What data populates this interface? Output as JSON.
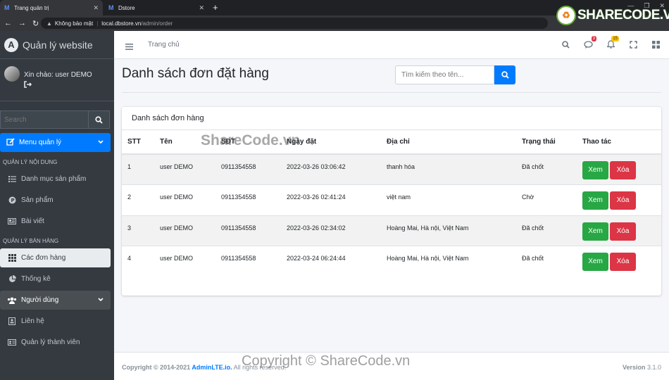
{
  "browser": {
    "tabs": [
      {
        "label": "Trang quản trị",
        "favicon": "M"
      },
      {
        "label": "Dstore",
        "favicon": "M"
      }
    ],
    "security_label": "Không bảo mật",
    "url_host": "local.dbstore.vn",
    "url_path": "/admin/order"
  },
  "sidebar": {
    "brand": "Quản lý website",
    "greeting": "Xin chào: user DEMO",
    "search_placeholder": "Search",
    "menu_toggle": "Menu quản lý",
    "section_content": "QUẢN LÝ NỘI DUNG",
    "section_sales": "QUẢN LÝ BÁN HÀNG",
    "items": [
      {
        "label": "Danh mục sản phẩm",
        "icon": "list-icon"
      },
      {
        "label": "Sản phẩm",
        "icon": "product-icon"
      },
      {
        "label": "Bài viết",
        "icon": "article-icon"
      },
      {
        "label": "Các đơn hàng",
        "icon": "grid-icon"
      },
      {
        "label": "Thống kê",
        "icon": "pie-chart-icon"
      },
      {
        "label": "Người dùng",
        "icon": "users-icon"
      },
      {
        "label": "Liên hệ",
        "icon": "contact-icon"
      },
      {
        "label": "Quản lý thành viên",
        "icon": "id-card-icon"
      }
    ]
  },
  "topnav": {
    "home": "Trang chủ",
    "messages_badge": "3",
    "notifications_badge": "15"
  },
  "header": {
    "title": "Danh sách đơn đặt hàng",
    "search_placeholder": "Tìm kiếm theo tên..."
  },
  "card": {
    "title": "Danh sách đơn hàng",
    "columns": [
      "STT",
      "Tên",
      "SĐT",
      "Ngày đặt",
      "Địa chỉ",
      "Trạng thái",
      "Thao tác"
    ],
    "rows": [
      {
        "stt": "1",
        "name": "user DEMO",
        "phone": "0911354558",
        "date": "2022-03-26 03:06:42",
        "address": "thanh hóa",
        "status": "Đã chốt"
      },
      {
        "stt": "2",
        "name": "user DEMO",
        "phone": "0911354558",
        "date": "2022-03-26 02:41:24",
        "address": "việt nam",
        "status": "Chờ"
      },
      {
        "stt": "3",
        "name": "user DEMO",
        "phone": "0911354558",
        "date": "2022-03-26 02:34:02",
        "address": "Hoàng Mai, Hà nội, Việt Nam",
        "status": "Đã chốt"
      },
      {
        "stt": "4",
        "name": "user DEMO",
        "phone": "0911354558",
        "date": "2022-03-24 06:24:44",
        "address": "Hoàng Mai, Hà nội, Việt Nam",
        "status": "Đã chốt"
      }
    ],
    "view_label": "Xem",
    "delete_label": "Xóa"
  },
  "footer": {
    "copyright": "Copyright © 2014-2021 ",
    "link": "AdminLTE.io.",
    "rest": " All rights reserved.",
    "version_label": "Version",
    "version": "3.1.0"
  },
  "watermarks": {
    "center": "ShareCode.vn",
    "bottom": "Copyright © ShareCode.vn",
    "logo": "SHARECODE.VN"
  },
  "colors": {
    "primary": "#007bff",
    "success": "#28a745",
    "danger": "#dc3545",
    "sidebar": "#343a40"
  }
}
